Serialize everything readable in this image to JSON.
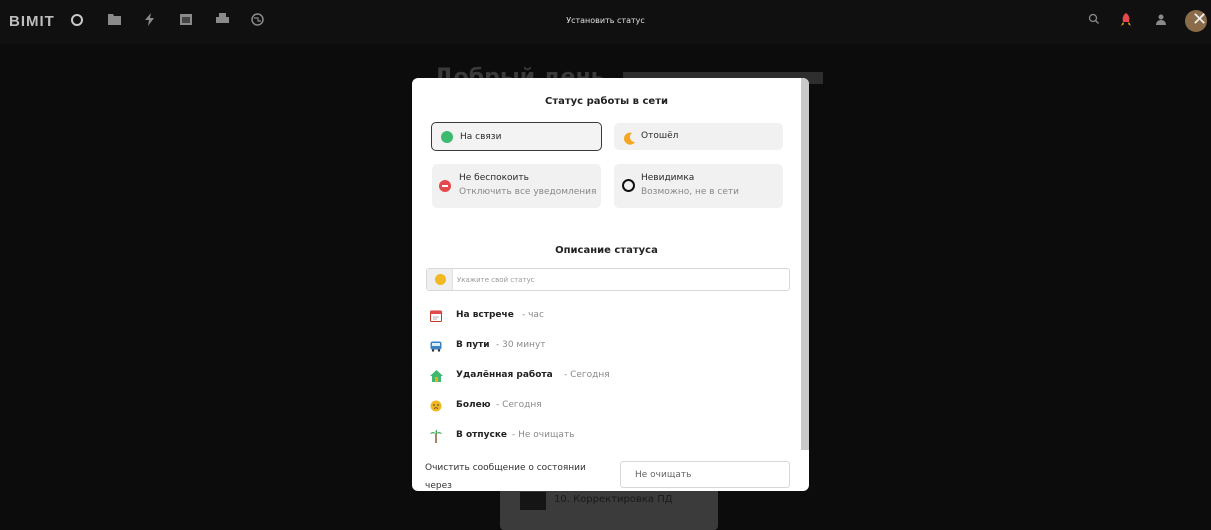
{
  "topbar": {
    "logo": "BIMIT",
    "title": "Установить статус",
    "icons": [
      "circle-icon",
      "folder-icon",
      "lightning-icon",
      "calendar-icon",
      "printer-icon",
      "globe-icon",
      "search-icon",
      "rocket-icon",
      "contacts-icon",
      "avatar",
      "close-icon"
    ]
  },
  "background": {
    "greeting": "Добрый день,",
    "card_text": "10. Корректировка ПД"
  },
  "modal": {
    "online_heading": "Статус работы в сети",
    "options": [
      {
        "id": "online",
        "label": "На связи",
        "sub": "",
        "icon": "green-dot-icon",
        "color": "#3dba6f",
        "selected": true
      },
      {
        "id": "away",
        "label": "Отошёл",
        "sub": "",
        "icon": "moon-icon",
        "color": "#f5a623",
        "selected": false
      },
      {
        "id": "dnd",
        "label": "Не беспокоить",
        "sub": "Отключить все уведомления",
        "icon": "minus-circle-icon",
        "color": "#e5484d",
        "selected": false
      },
      {
        "id": "invisible",
        "label": "Невидимка",
        "sub": "Возможно, не в сети",
        "icon": "ring-icon",
        "color": "#111111",
        "selected": false
      }
    ],
    "desc_heading": "Описание статуса",
    "input": {
      "placeholder": "Укажите свой статус",
      "value": ""
    },
    "presets": [
      {
        "name": "На встрече",
        "duration": " - час",
        "icon": "calendar-icon"
      },
      {
        "name": "В пути",
        "duration": " - 30 минут",
        "icon": "bus-icon"
      },
      {
        "name": "Удалённая работа",
        "duration": " - Сегодня",
        "icon": "house-icon"
      },
      {
        "name": "Болею",
        "duration": " - Сегодня",
        "icon": "sick-face-icon"
      },
      {
        "name": "В отпуске",
        "duration": " - Не очищать",
        "icon": "palm-tree-icon"
      }
    ],
    "clear_label": "Очистить сообщение о состоянии через",
    "clear_value": "Не очищать"
  }
}
